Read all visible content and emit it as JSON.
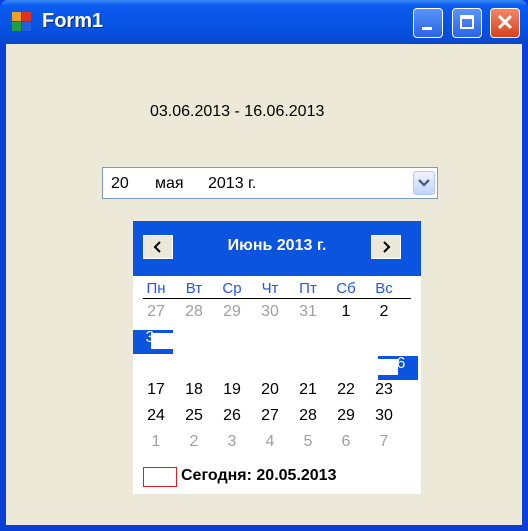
{
  "window": {
    "title": "Form1"
  },
  "range_label": "03.06.2013 - 16.06.2013",
  "date_picker": {
    "day": "20",
    "month": "мая",
    "year": "2013 г."
  },
  "calendar": {
    "title": "Июнь 2013 г.",
    "weekdays": [
      "Пн",
      "Вт",
      "Ср",
      "Чт",
      "Пт",
      "Сб",
      "Вс"
    ],
    "rows": [
      [
        "27",
        "28",
        "29",
        "30",
        "31",
        "1",
        "2"
      ],
      [
        "3",
        "",
        "",
        "",
        "",
        "",
        ""
      ],
      [
        "",
        "",
        "",
        "",
        "",
        "",
        "6"
      ],
      [
        "17",
        "18",
        "19",
        "20",
        "21",
        "22",
        "23"
      ],
      [
        "24",
        "25",
        "26",
        "27",
        "28",
        "29",
        "30"
      ],
      [
        "1",
        "2",
        "3",
        "4",
        "5",
        "6",
        "7"
      ]
    ],
    "other_month": [
      [
        true,
        true,
        true,
        true,
        true,
        false,
        false
      ],
      [
        false,
        false,
        false,
        false,
        false,
        false,
        false
      ],
      [
        false,
        false,
        false,
        false,
        false,
        false,
        false
      ],
      [
        false,
        false,
        false,
        false,
        false,
        false,
        false
      ],
      [
        false,
        false,
        false,
        false,
        false,
        false,
        false
      ],
      [
        true,
        true,
        true,
        true,
        true,
        true,
        true
      ]
    ],
    "today_label": "Сегодня: 20.05.2013"
  },
  "colors": {
    "title_bar": "#0855e6",
    "client_bg": "#ece9d8",
    "calendar_header": "#0a54e0",
    "weekday_text": "#2255ee",
    "other_month_text": "#a0a0a0",
    "today_marker": "#e02020"
  }
}
